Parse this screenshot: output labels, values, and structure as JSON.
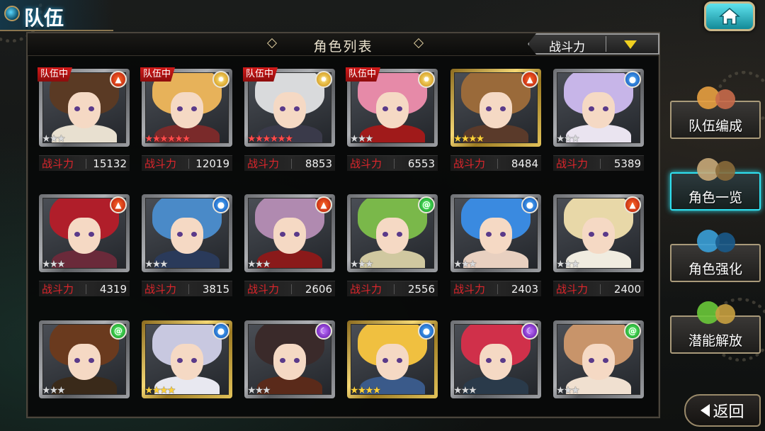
{
  "header": {
    "title": "队伍"
  },
  "home_button": {
    "icon": "home-icon"
  },
  "panel": {
    "title": "角色列表",
    "sort": {
      "selected": "战斗力"
    }
  },
  "power_label": "战斗力",
  "characters": [
    {
      "in_team": "队伍中",
      "element": "fire",
      "stars": 3,
      "star_color": "silver",
      "frame": "silver",
      "power": "15132",
      "hair": "#5a3a24",
      "body": "#e8e0d0"
    },
    {
      "in_team": "队伍中",
      "element": "light",
      "stars": 6,
      "star_color": "red",
      "frame": "silver",
      "power": "12019",
      "hair": "#e7b25a",
      "body": "#7a2a2a"
    },
    {
      "in_team": "队伍中",
      "element": "light",
      "stars": 6,
      "star_color": "red",
      "frame": "silver",
      "power": "8853",
      "hair": "#d9dadc",
      "body": "#3a3a4a"
    },
    {
      "in_team": "队伍中",
      "element": "light",
      "stars": 3,
      "star_color": "silver",
      "frame": "silver",
      "power": "6553",
      "hair": "#e68aa8",
      "body": "#a01a1a"
    },
    {
      "in_team": "",
      "element": "fire",
      "stars": 4,
      "star_color": "gold",
      "frame": "gold",
      "power": "8484",
      "hair": "#9a6a3a",
      "body": "#5a3a2a"
    },
    {
      "in_team": "",
      "element": "water",
      "stars": 3,
      "star_color": "silver",
      "frame": "silver",
      "power": "5389",
      "hair": "#c7b5e8",
      "body": "#eae4f0"
    },
    {
      "in_team": "",
      "element": "fire",
      "stars": 3,
      "star_color": "silver",
      "frame": "silver",
      "power": "4319",
      "hair": "#b01e2a",
      "body": "#6a2a3a"
    },
    {
      "in_team": "",
      "element": "water",
      "stars": 3,
      "star_color": "silver",
      "frame": "silver",
      "power": "3815",
      "hair": "#4a8ac8",
      "body": "#2a3a5a"
    },
    {
      "in_team": "",
      "element": "fire",
      "stars": 3,
      "star_color": "silver",
      "frame": "silver",
      "power": "2606",
      "hair": "#b08ab0",
      "body": "#8a1a1a"
    },
    {
      "in_team": "",
      "element": "wind",
      "stars": 3,
      "star_color": "silver",
      "frame": "silver",
      "power": "2556",
      "hair": "#7ab84a",
      "body": "#d0c8a0"
    },
    {
      "in_team": "",
      "element": "water",
      "stars": 3,
      "star_color": "silver",
      "frame": "silver",
      "power": "2403",
      "hair": "#3a8ae0",
      "body": "#e8d0c0"
    },
    {
      "in_team": "",
      "element": "fire",
      "stars": 3,
      "star_color": "silver",
      "frame": "silver",
      "power": "2400",
      "hair": "#e8d8a8",
      "body": "#f0ece0"
    },
    {
      "in_team": "",
      "element": "wind",
      "stars": 3,
      "star_color": "silver",
      "frame": "silver",
      "power": "",
      "hair": "#6a3a1e",
      "body": "#3a2a1a"
    },
    {
      "in_team": "",
      "element": "water",
      "stars": 4,
      "star_color": "gold",
      "frame": "gold",
      "power": "",
      "hair": "#c8c8e0",
      "body": "#e8e8f0"
    },
    {
      "in_team": "",
      "element": "dark",
      "stars": 3,
      "star_color": "silver",
      "frame": "silver",
      "power": "",
      "hair": "#3a2a2a",
      "body": "#5a2a1a"
    },
    {
      "in_team": "",
      "element": "water",
      "stars": 4,
      "star_color": "gold",
      "frame": "gold",
      "power": "",
      "hair": "#f0c040",
      "body": "#3a5a8a"
    },
    {
      "in_team": "",
      "element": "dark",
      "stars": 3,
      "star_color": "silver",
      "frame": "silver",
      "power": "",
      "hair": "#d0304a",
      "body": "#2a3a4a"
    },
    {
      "in_team": "",
      "element": "wind",
      "stars": 3,
      "star_color": "silver",
      "frame": "silver",
      "power": "",
      "hair": "#c8946a",
      "body": "#f0e0d0"
    }
  ],
  "menu": [
    {
      "label": "队伍编成",
      "icon": "team-formation-icon",
      "active": false
    },
    {
      "label": "角色一览",
      "icon": "character-book-icon",
      "active": true
    },
    {
      "label": "角色强化",
      "icon": "enhance-icon",
      "active": false
    },
    {
      "label": "潜能解放",
      "icon": "potential-orb-icon",
      "active": false
    }
  ],
  "back_button": {
    "label": "返回",
    "icon": "back-arrow-icon"
  }
}
